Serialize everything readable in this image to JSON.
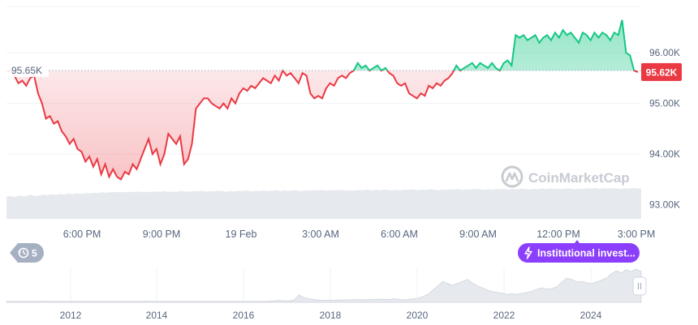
{
  "chart_data": {
    "type": "line",
    "title": "",
    "xlabel": "",
    "ylabel": "",
    "baseline_value": 95.65,
    "baseline_label": "95.65K",
    "current_value": 95.62,
    "current_label": "95.62K",
    "ylim": [
      92.4,
      96.9
    ],
    "y_ticks": [
      {
        "value": 96.0,
        "label": "96.00K"
      },
      {
        "value": 95.0,
        "label": "95.00K"
      },
      {
        "value": 94.0,
        "label": "94.00K"
      },
      {
        "value": 93.0,
        "label": "93.00K"
      }
    ],
    "x_ticks": [
      "6:00 PM",
      "9:00 PM",
      "19 Feb",
      "3:00 AM",
      "6:00 AM",
      "9:00 AM",
      "12:00 PM",
      "3:00 PM"
    ],
    "grid": true,
    "series": [
      {
        "values": [
          95.62,
          95.65,
          95.55,
          95.4,
          95.45,
          95.35,
          95.5,
          95.55,
          95.2,
          95.0,
          94.7,
          94.75,
          94.6,
          94.65,
          94.45,
          94.35,
          94.2,
          94.3,
          94.1,
          94.05,
          93.85,
          93.95,
          93.75,
          93.9,
          93.6,
          93.8,
          93.55,
          93.7,
          93.55,
          93.5,
          93.65,
          93.6,
          93.8,
          93.7,
          93.9,
          94.1,
          94.3,
          94.0,
          94.1,
          93.8,
          94.0,
          94.4,
          94.3,
          94.2,
          94.35,
          93.8,
          93.9,
          94.2,
          94.9,
          95.0,
          95.1,
          95.1,
          95.0,
          94.95,
          94.9,
          95.0,
          94.9,
          95.1,
          95.0,
          95.2,
          95.3,
          95.25,
          95.35,
          95.3,
          95.4,
          95.5,
          95.45,
          95.4,
          95.55,
          95.45,
          95.65,
          95.55,
          95.6,
          95.5,
          95.4,
          95.6,
          95.55,
          95.2,
          95.1,
          95.15,
          95.1,
          95.3,
          95.4,
          95.35,
          95.5,
          95.55,
          95.5,
          95.6,
          95.65,
          95.8,
          95.7,
          95.75,
          95.65,
          95.7,
          95.75,
          95.65,
          95.7,
          95.6,
          95.55,
          95.4,
          95.35,
          95.4,
          95.2,
          95.15,
          95.1,
          95.2,
          95.15,
          95.35,
          95.3,
          95.4,
          95.35,
          95.45,
          95.5,
          95.6,
          95.75,
          95.65,
          95.7,
          95.75,
          95.8,
          95.7,
          95.8,
          95.75,
          95.7,
          95.8,
          95.7,
          95.65,
          95.8,
          95.85,
          95.75,
          96.35,
          96.3,
          96.35,
          96.25,
          96.3,
          96.35,
          96.2,
          96.3,
          96.35,
          96.25,
          96.4,
          96.3,
          96.45,
          96.35,
          96.4,
          96.3,
          96.2,
          96.4,
          96.35,
          96.25,
          96.4,
          96.3,
          96.4,
          96.35,
          96.25,
          96.4,
          96.35,
          96.65,
          96.0,
          95.95,
          95.65,
          95.62
        ],
        "x_range": [
          "5:00 PM",
          "3:05 PM"
        ]
      }
    ],
    "volume_values": [
      0.72,
      0.74,
      0.7,
      0.76,
      0.73,
      0.75,
      0.78,
      0.74,
      0.76,
      0.79,
      0.77,
      0.8,
      0.78,
      0.81,
      0.79,
      0.82,
      0.8,
      0.83,
      0.81,
      0.84,
      0.83,
      0.85,
      0.84,
      0.86,
      0.85,
      0.86,
      0.88,
      0.86,
      0.87,
      0.86,
      0.88,
      0.87,
      0.89,
      0.86,
      0.88,
      0.87,
      0.89,
      0.88,
      0.9,
      0.87,
      0.89,
      0.88,
      0.9,
      0.89,
      0.88,
      0.9,
      0.89,
      0.91,
      0.88,
      0.9,
      0.89,
      0.91,
      0.9,
      0.88,
      0.9,
      0.89,
      0.91,
      0.9,
      0.92,
      0.89,
      0.91,
      0.9,
      0.92,
      0.9,
      0.91,
      0.93,
      0.9,
      0.92,
      0.91,
      0.93,
      0.92,
      0.9,
      0.92,
      0.91,
      0.93,
      0.92,
      0.94,
      0.91,
      0.93,
      0.92,
      0.94,
      0.93,
      0.91,
      0.93,
      0.92,
      0.94,
      0.93,
      0.95,
      0.92,
      0.94,
      0.93,
      0.95,
      0.94,
      0.92,
      0.94,
      0.93,
      0.95,
      0.94,
      0.96,
      0.93,
      0.95,
      0.94,
      0.96,
      0.95,
      0.93,
      0.95,
      0.94,
      0.96,
      0.95,
      0.97,
      0.94,
      0.96,
      0.95,
      0.97,
      0.96,
      0.94,
      0.96,
      0.95,
      0.97,
      0.96,
      0.98,
      0.95,
      0.97,
      0.96,
      0.98,
      0.97,
      0.95,
      0.97,
      0.96,
      0.98,
      0.97,
      0.99,
      0.96,
      0.98,
      0.97,
      0.99,
      0.98,
      0.96,
      0.98,
      0.97,
      0.99,
      0.98,
      1.0,
      0.97,
      0.99,
      0.98,
      1.0,
      0.99,
      0.97,
      0.99,
      0.98,
      1.0,
      0.99,
      0.98
    ],
    "overview": {
      "x_ticks": [
        "2012",
        "2014",
        "2016",
        "2018",
        "2020",
        "2022",
        "2024"
      ],
      "values": [
        0.0,
        0.0,
        0.0,
        0.0,
        0.0,
        0.0,
        0.0,
        0.01,
        0.0,
        0.0,
        0.0,
        0.0,
        0.0,
        0.0,
        0.0,
        0.0,
        0.0,
        0.0,
        0.0,
        0.0,
        0.0,
        0.0,
        0.0,
        0.0,
        0.0,
        0.0,
        0.0,
        0.0,
        0.01,
        0.0,
        0.0,
        0.0,
        0.0,
        0.0,
        0.0,
        0.0,
        0.0,
        0.0,
        0.0,
        0.0,
        0.0,
        0.0,
        0.0,
        0.0,
        0.0,
        0.0,
        0.0,
        0.0,
        0.0,
        0.0,
        0.0,
        0.0,
        0.0,
        0.01,
        0.02,
        0.03,
        0.02,
        0.02,
        0.04,
        0.2,
        0.12,
        0.08,
        0.06,
        0.04,
        0.04,
        0.03,
        0.04,
        0.04,
        0.05,
        0.05,
        0.06,
        0.06,
        0.05,
        0.06,
        0.06,
        0.07,
        0.07,
        0.06,
        0.08,
        0.07,
        0.05,
        0.06,
        0.08,
        0.1,
        0.15,
        0.22,
        0.35,
        0.48,
        0.62,
        0.55,
        0.5,
        0.56,
        0.62,
        0.68,
        0.56,
        0.48,
        0.42,
        0.35,
        0.3,
        0.28,
        0.25,
        0.22,
        0.24,
        0.22,
        0.25,
        0.28,
        0.32,
        0.38,
        0.42,
        0.38,
        0.4,
        0.45,
        0.6,
        0.72,
        0.68,
        0.6,
        0.62,
        0.58,
        0.55,
        0.6,
        0.66,
        0.72,
        0.85,
        0.95,
        0.88,
        0.98,
        0.92,
        1.0,
        0.92
      ]
    }
  },
  "watermark": {
    "text": "CoinMarketCap"
  },
  "events": {
    "count": "5"
  },
  "news_badge": {
    "text": "Institutional invest..."
  },
  "colors": {
    "up": "#16c784",
    "down": "#ea3943",
    "label_bg": "#ea3943",
    "badge_purple": "#8b3ffc",
    "grid": "#eff2f5",
    "axis_text": "#58667e"
  }
}
